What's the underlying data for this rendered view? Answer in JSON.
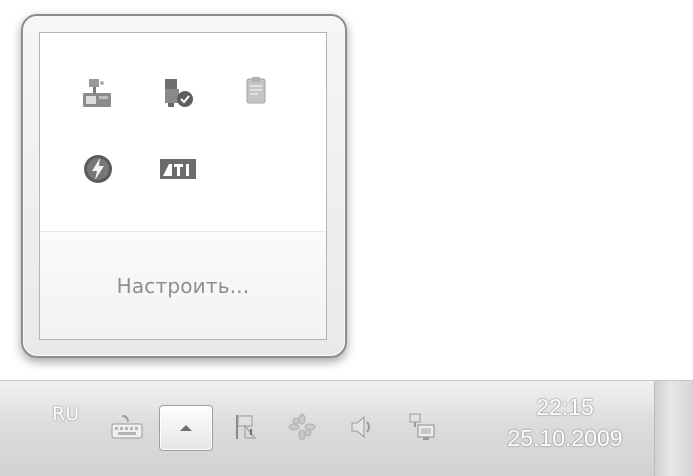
{
  "overflow_popup": {
    "icons": [
      {
        "name": "network-connections-icon"
      },
      {
        "name": "security-center-icon"
      },
      {
        "name": "clipboard-document-icon"
      },
      {
        "name": "power-lightning-icon"
      },
      {
        "name": "ati-catalyst-icon",
        "text": "ATI"
      }
    ],
    "customize_label": "Настроить..."
  },
  "taskbar": {
    "language": "RU",
    "tray_icons": [
      "keyboard-icon",
      "show-hidden-icons-arrow",
      "action-center-flag-icon",
      "pinwheel-icon",
      "speaker-volume-icon",
      "network-icon"
    ],
    "clock": {
      "time": "22:15",
      "date": "25.10.2009"
    }
  }
}
